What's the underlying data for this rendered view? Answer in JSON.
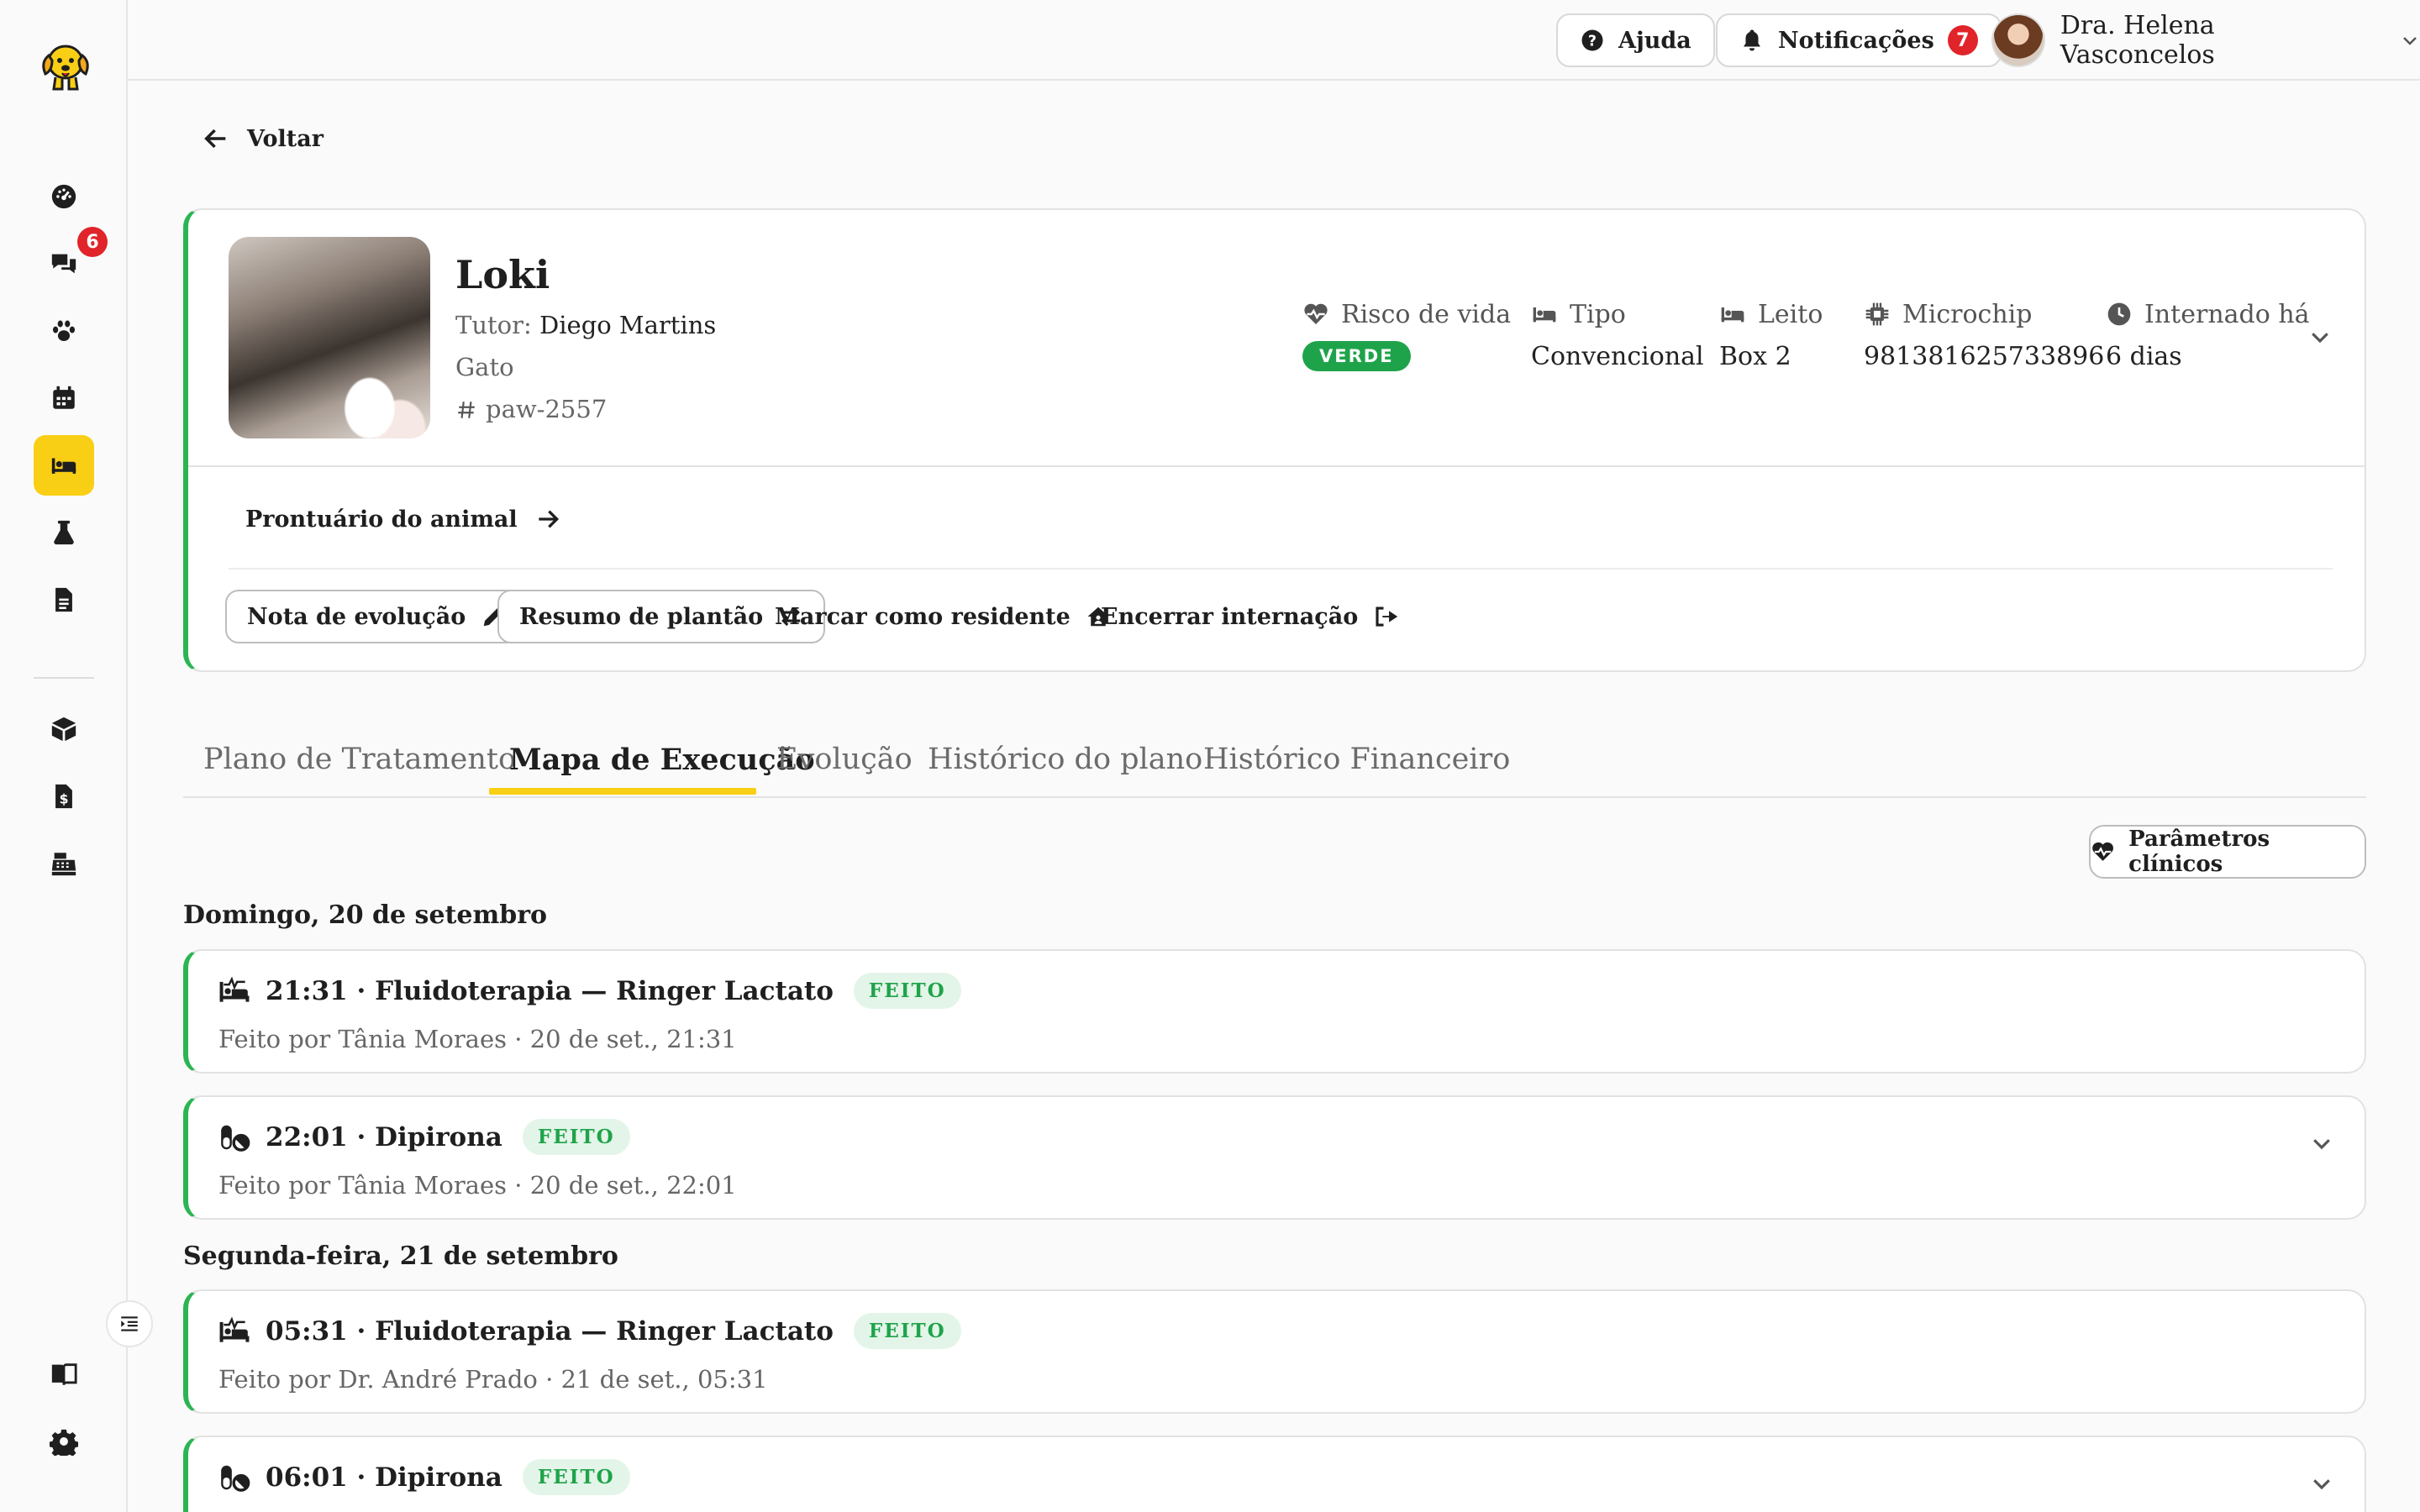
{
  "app": {
    "logo": "dog-logo",
    "accent": "#f9cf15",
    "success": "#2bb552"
  },
  "sidebar": {
    "items": [
      {
        "icon": "dashboard-icon"
      },
      {
        "icon": "chat-icon",
        "badge": "6"
      },
      {
        "icon": "paw-icon"
      },
      {
        "icon": "calendar-icon"
      },
      {
        "icon": "bed-icon",
        "active": true
      },
      {
        "icon": "flask-icon"
      },
      {
        "icon": "document-icon"
      },
      {
        "icon": "box-icon"
      },
      {
        "icon": "invoice-icon"
      },
      {
        "icon": "cash-register-icon"
      },
      {
        "icon": "book-icon"
      },
      {
        "icon": "gear-icon"
      }
    ]
  },
  "topbar": {
    "help_label": "Ajuda",
    "notifications_label": "Notificações",
    "notifications_count": "7",
    "user_name": "Dra. Helena Vasconcelos"
  },
  "back_label": "Voltar",
  "patient": {
    "name": "Loki",
    "tutor_label": "Tutor:",
    "tutor_name": "Diego Martins",
    "species": "Gato",
    "id": "paw-2557",
    "meta": {
      "risk_label": "Risco de vida",
      "risk_value": "VERDE",
      "type_label": "Tipo",
      "type_value": "Convencional",
      "bed_label": "Leito",
      "bed_value": "Box 2",
      "chip_label": "Microchip",
      "chip_value": "981381625733896",
      "admitted_label": "Internado há",
      "admitted_value": "6 dias"
    },
    "record_link": "Prontuário do animal",
    "actions": {
      "evolution_note": "Nota de evolução",
      "shift_summary": "Resumo de plantão",
      "mark_resident": "Marcar como residente",
      "end_hospitalization": "Encerrar internação"
    }
  },
  "tabs": [
    {
      "label": "Plano de Tratamento"
    },
    {
      "label": "Mapa de Execução",
      "active": true
    },
    {
      "label": "Evolução"
    },
    {
      "label": "Histórico do plano"
    },
    {
      "label": "Histórico Financeiro"
    }
  ],
  "clinical_params_label": "Parâmetros clínicos",
  "days": [
    {
      "label": "Domingo, 20 de setembro",
      "entries": [
        {
          "icon": "bed-pulse-icon",
          "title": "21:31 · Fluidoterapia — Ringer Lactato",
          "status": "FEITO",
          "sub": "Feito por Tânia Moraes · 20 de set., 21:31"
        },
        {
          "icon": "pills-icon",
          "title": "22:01 · Dipirona",
          "status": "FEITO",
          "sub": "Feito por Tânia Moraes · 20 de set., 22:01"
        }
      ]
    },
    {
      "label": "Segunda-feira, 21 de setembro",
      "entries": [
        {
          "icon": "bed-pulse-icon",
          "title": "05:31 · Fluidoterapia — Ringer Lactato",
          "status": "FEITO",
          "sub": "Feito por Dr. André Prado · 21 de set., 05:31"
        },
        {
          "icon": "pills-icon",
          "title": "06:01 · Dipirona",
          "status": "FEITO",
          "sub": ""
        }
      ]
    }
  ]
}
